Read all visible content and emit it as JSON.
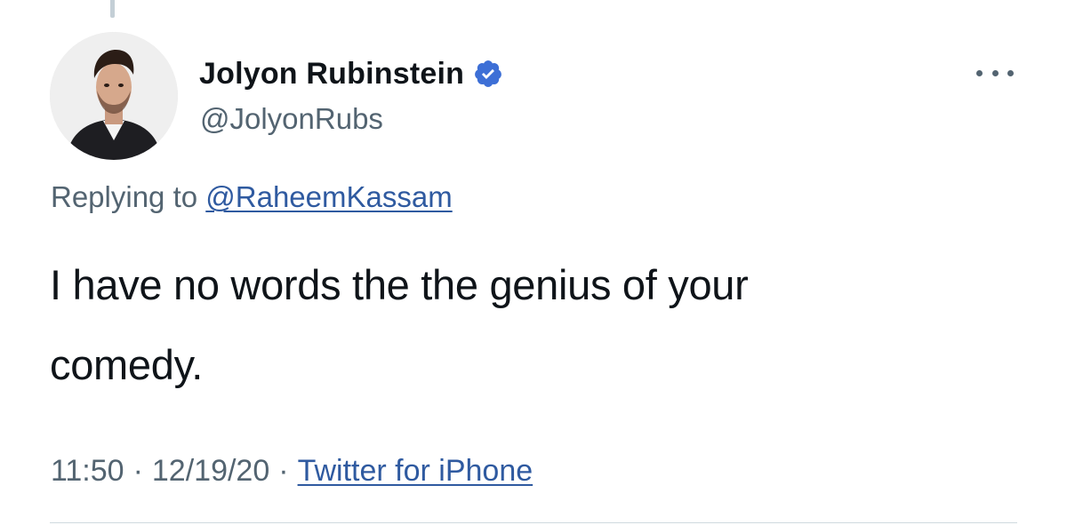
{
  "tweet": {
    "author": {
      "display_name": "Jolyon Rubinstein",
      "handle": "@JolyonRubs",
      "verified": true,
      "avatar_icon": "profile-photo"
    },
    "reply": {
      "prefix": "Replying to ",
      "to_handle": "@RaheemKassam"
    },
    "text_line1": "I have no words the the genius of your",
    "text_line2": "comedy.",
    "meta": {
      "time": "11:50",
      "separator": "·",
      "date": "12/19/20",
      "source": "Twitter for iPhone"
    },
    "more_menu_icon": "more-horizontal-icon"
  },
  "colors": {
    "verified_badge": "#3d6fd6",
    "link": "#2f5aa0",
    "secondary_text": "#536471",
    "primary_text": "#0f1419"
  }
}
